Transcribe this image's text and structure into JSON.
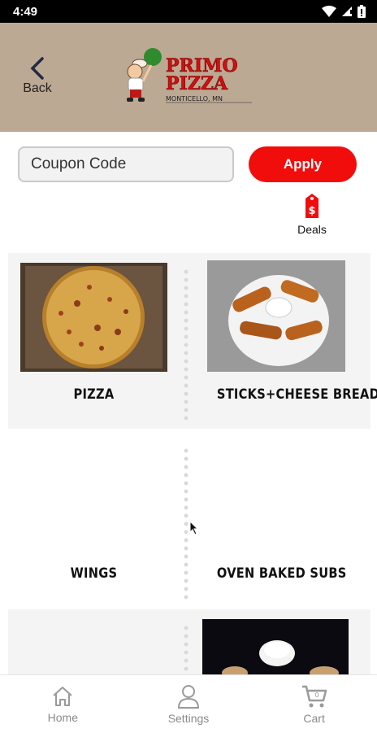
{
  "status_bar": {
    "time": "4:49"
  },
  "header": {
    "back_label": "Back",
    "logo": {
      "line1": "PRIMO",
      "line2": "PIZZA",
      "location": "MONTICELLO, MN"
    }
  },
  "coupon": {
    "placeholder": "Coupon Code",
    "apply_label": "Apply"
  },
  "deals": {
    "label": "Deals"
  },
  "categories": [
    {
      "name": "PIZZA"
    },
    {
      "name": "STICKS+CHEESE BREAD"
    },
    {
      "name": "WINGS"
    },
    {
      "name": "OVEN BAKED SUBS"
    }
  ],
  "bottom_nav": {
    "items": [
      {
        "label": "Home",
        "icon": "home-icon"
      },
      {
        "label": "Settings",
        "icon": "person-icon"
      },
      {
        "label": "Cart",
        "icon": "cart-icon"
      }
    ]
  },
  "colors": {
    "header_bg": "#bca994",
    "accent": "#f20d0d",
    "logo_green": "#2e8b2e"
  }
}
